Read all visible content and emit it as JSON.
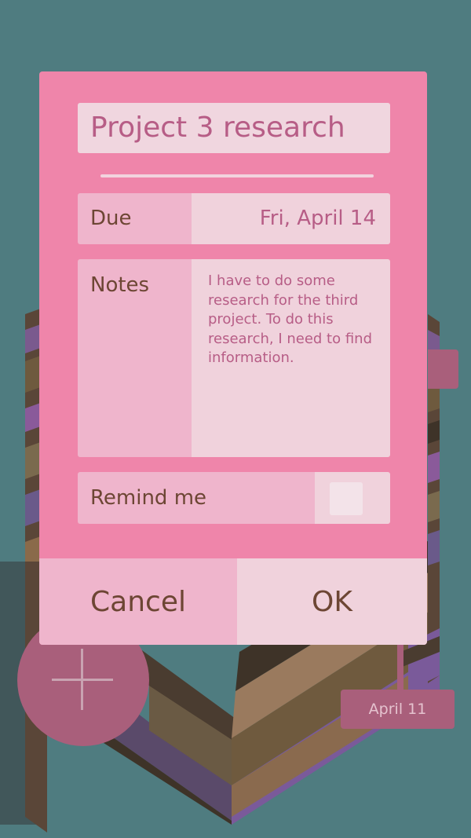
{
  "dialog": {
    "title": "Project 3 research",
    "due": {
      "label": "Due",
      "value": "Fri, April 14"
    },
    "notes": {
      "label": "Notes",
      "value": "I have to do some research for the third project. To do this research, I need to find information."
    },
    "remind": {
      "label": "Remind me",
      "checked": false
    },
    "cancel_label": "Cancel",
    "ok_label": "OK"
  },
  "background": {
    "date_tag": "April 11",
    "add_icon": "plus-icon"
  },
  "colors": {
    "background": "#4f7c80",
    "dialog": "#ef85aa",
    "accent": "#a95f7b",
    "text_brown": "#6d4634",
    "text_pink": "#b75d86"
  }
}
